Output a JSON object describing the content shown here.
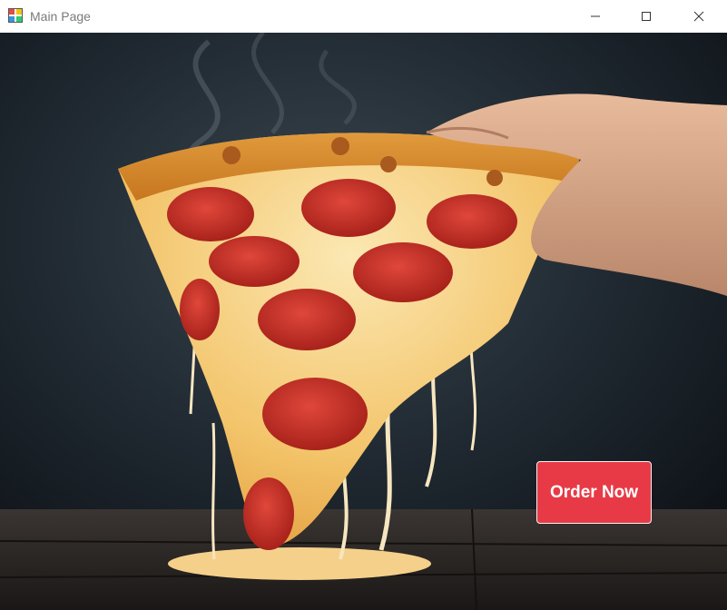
{
  "window": {
    "title": "Main Page",
    "controls": {
      "minimize": "minimize-icon",
      "maximize": "maximize-icon",
      "close": "close-icon"
    }
  },
  "hero": {
    "image": "pepperoni-pizza-slice-photo",
    "order_button_label": "Order Now"
  },
  "colors": {
    "titlebar": "#ffffff",
    "title_text": "#7a7a7a",
    "background": "#1a1d22",
    "button": "#e83a46",
    "button_text": "#ffffff"
  }
}
